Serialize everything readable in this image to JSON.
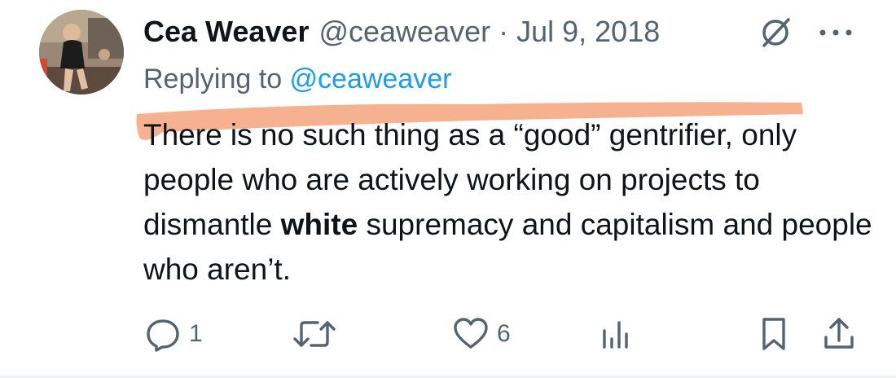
{
  "tweet": {
    "author_name": "Cea Weaver",
    "author_handle": "@ceaweaver",
    "separator": "·",
    "date": "Jul 9, 2018",
    "replying_prefix": "Replying to ",
    "replying_handle": "@ceaweaver",
    "text": {
      "part1": "There is no such thing as a “good” gentrifier, only people who are actively working on projects to dismantle ",
      "bold": "white",
      "part2": " supremacy and capitalism and people who aren’t."
    },
    "highlight_color": "#f5a37c"
  },
  "actions": {
    "reply_count": "1",
    "like_count": "6"
  },
  "icons": [
    "grok-icon",
    "more-icon",
    "reply-icon",
    "retweet-icon",
    "like-icon",
    "views-icon",
    "bookmark-icon",
    "share-icon"
  ]
}
